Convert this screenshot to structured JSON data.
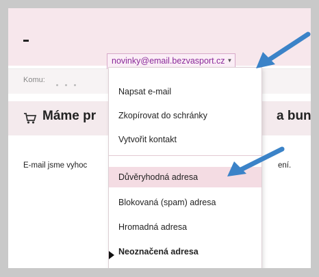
{
  "header": {
    "sender_email": "novinky@email.bezvasport.cz"
  },
  "recipient": {
    "label": "Komu:"
  },
  "subject": {
    "text_left": "Máme pr",
    "text_right": "a bundy,"
  },
  "body": {
    "text_left": "E-mail jsme vyhoc",
    "text_right": "ení."
  },
  "context_menu": {
    "items": [
      {
        "label": "Napsat e-mail"
      },
      {
        "label": "Zkopírovat do schránky"
      },
      {
        "label": "Vytvořit kontakt"
      },
      {
        "label": "Důvěryhodná adresa"
      },
      {
        "label": "Blokovaná (spam) adresa"
      },
      {
        "label": "Hromadná adresa"
      },
      {
        "label": "Neoznačená adresa"
      }
    ],
    "highlighted_index": 3,
    "selected_index": 6
  },
  "colors": {
    "arrow": "#3b83c8",
    "highlight": "#f4dce3",
    "email_text": "#8a2a9a"
  },
  "icons": [
    "shopping-cart-icon",
    "dropdown-caret-icon",
    "selection-pointer-icon",
    "callout-arrow-icon"
  ]
}
